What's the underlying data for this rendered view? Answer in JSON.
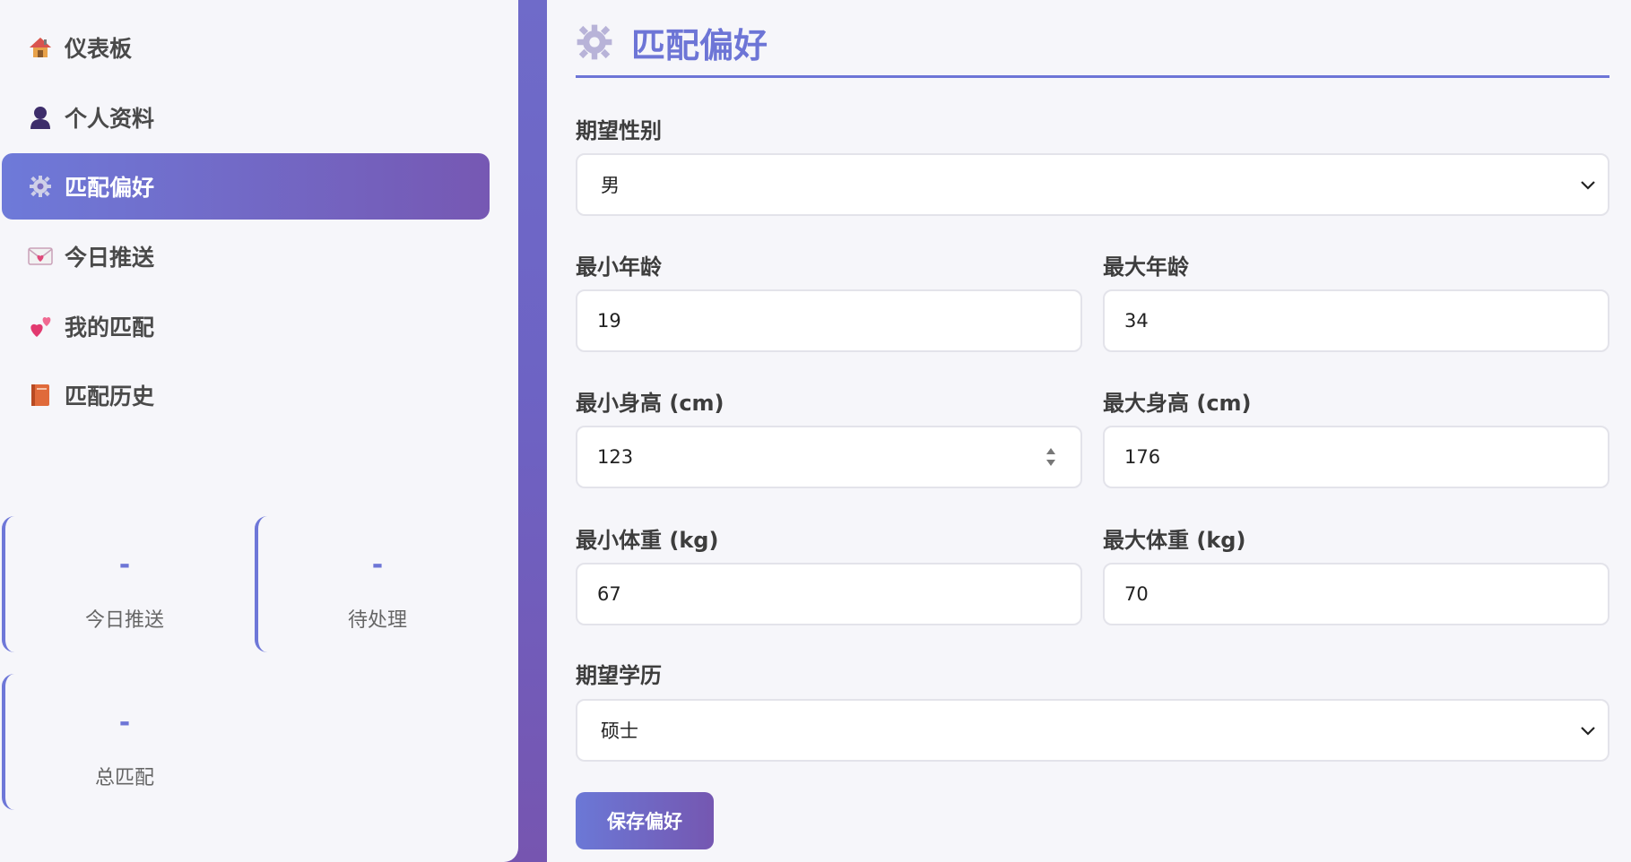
{
  "sidebar": {
    "items": [
      {
        "label": "仪表板",
        "icon": "house-icon"
      },
      {
        "label": "个人资料",
        "icon": "person-icon"
      },
      {
        "label": "匹配偏好",
        "icon": "gear-icon",
        "active": true
      },
      {
        "label": "今日推送",
        "icon": "love-letter-icon"
      },
      {
        "label": "我的匹配",
        "icon": "two-hearts-icon"
      },
      {
        "label": "匹配历史",
        "icon": "book-icon"
      }
    ],
    "stats": [
      {
        "value": "-",
        "label": "今日推送"
      },
      {
        "value": "-",
        "label": "待处理"
      },
      {
        "value": "-",
        "label": "总匹配"
      }
    ]
  },
  "main": {
    "title": "匹配偏好",
    "title_icon": "gear-icon",
    "gender": {
      "label": "期望性别",
      "value": "男"
    },
    "min_age": {
      "label": "最小年龄",
      "value": "19"
    },
    "max_age": {
      "label": "最大年龄",
      "value": "34"
    },
    "min_height": {
      "label": "最小身高 (cm)",
      "value": "123"
    },
    "max_height": {
      "label": "最大身高 (cm)",
      "value": "176"
    },
    "min_weight": {
      "label": "最小体重 (kg)",
      "value": "67"
    },
    "max_weight": {
      "label": "最大体重 (kg)",
      "value": "70"
    },
    "education": {
      "label": "期望学历",
      "value": "硕士"
    },
    "save_label": "保存偏好"
  },
  "colors": {
    "accent": "#6d75d6",
    "accent_gradient_end": "#7557b1",
    "background": "#f6f6fa"
  }
}
